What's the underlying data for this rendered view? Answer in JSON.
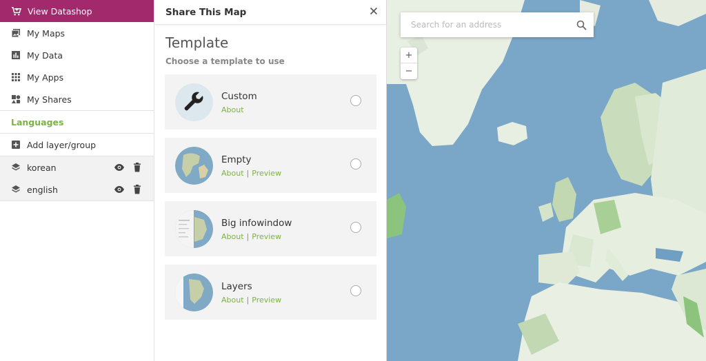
{
  "sidebar": {
    "datashop_label": "View Datashop",
    "nav": [
      {
        "label": "My Maps",
        "icon": "maps-icon"
      },
      {
        "label": "My Data",
        "icon": "data-icon"
      },
      {
        "label": "My Apps",
        "icon": "apps-icon"
      },
      {
        "label": "My Shares",
        "icon": "shares-icon"
      }
    ],
    "languages_title": "Languages",
    "add_layer_label": "Add layer/group",
    "layers": [
      {
        "name": "korean"
      },
      {
        "name": "english"
      }
    ]
  },
  "panel": {
    "title": "Share This Map",
    "template_title": "Template",
    "template_subtitle": "Choose a template to use",
    "templates": [
      {
        "title": "Custom",
        "about": "About",
        "preview": ""
      },
      {
        "title": "Empty",
        "about": "About",
        "preview": "Preview"
      },
      {
        "title": "Big infowindow",
        "about": "About",
        "preview": "Preview"
      },
      {
        "title": "Layers",
        "about": "About",
        "preview": "Preview"
      }
    ]
  },
  "map": {
    "search_placeholder": "Search for an address",
    "zoom_in": "+",
    "zoom_out": "−"
  },
  "colors": {
    "accent": "#a3296d",
    "green": "#7cb342",
    "ocean": "#7ea9c9"
  }
}
